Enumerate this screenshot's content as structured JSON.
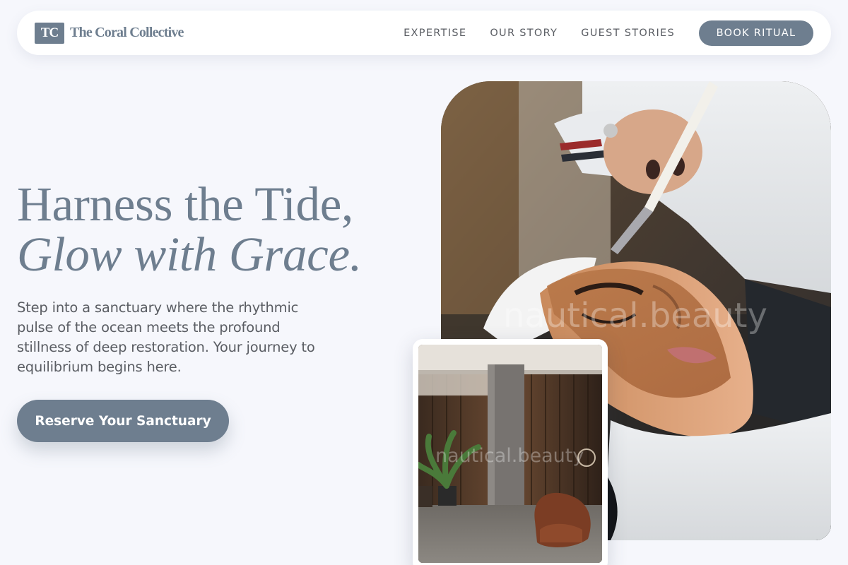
{
  "brand": {
    "mark": "TC",
    "name": "The Coral Collective"
  },
  "nav": {
    "links": [
      "EXPERTISE",
      "OUR STORY",
      "GUEST STORIES"
    ],
    "cta": "BOOK RITUAL"
  },
  "hero": {
    "title_line1": "Harness the Tide,",
    "title_line2": "Glow with Grace.",
    "description": "Step into a sanctuary where the rhythmic pulse of the ocean meets the profound stillness of deep restoration. Your journey to equilibrium begins here.",
    "cta": "Reserve Your Sanctuary"
  },
  "images": {
    "main": {
      "subject": "facial-treatment-photo",
      "watermark": "nautical.beauty"
    },
    "secondary": {
      "subject": "spa-interior-photo",
      "watermark": "nautical.beauty"
    }
  },
  "colors": {
    "accent": "#6e7e8f",
    "background": "#f6f7fc",
    "text": "#5a5d63",
    "white": "#ffffff"
  }
}
